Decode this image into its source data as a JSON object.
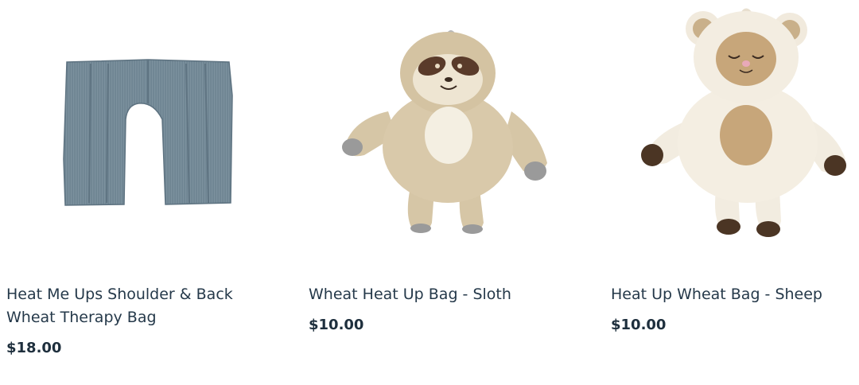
{
  "products": [
    {
      "title": "Heat Me Ups Shoulder & Back Wheat Therapy Bag",
      "price": "$18.00",
      "image_icon": "shoulder-wrap-image",
      "colors": {
        "fabric": "#6f8593"
      }
    },
    {
      "title": "Wheat Heat Up Bag - Sloth",
      "price": "$10.00",
      "image_icon": "sloth-plush-image",
      "colors": {
        "fur": "#d8c8a8"
      }
    },
    {
      "title": "Heat Up Wheat Bag - Sheep",
      "price": "$10.00",
      "image_icon": "sheep-plush-image",
      "colors": {
        "fleece": "#f2ece0"
      }
    }
  ]
}
